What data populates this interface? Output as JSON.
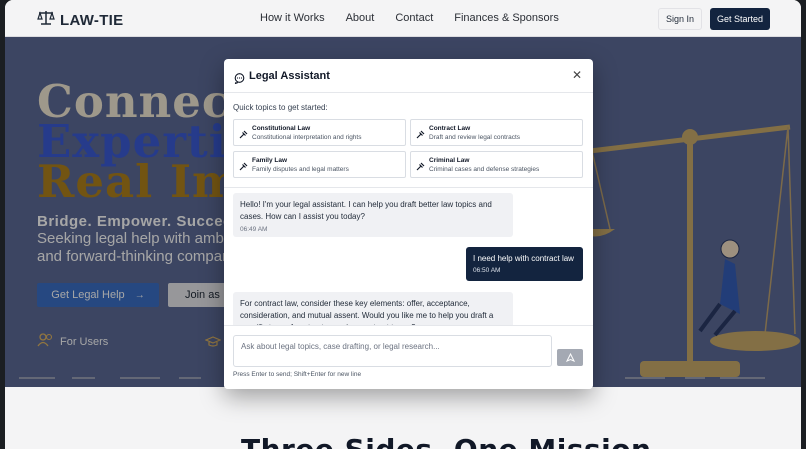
{
  "header": {
    "brand": "LAW-TIE",
    "nav": [
      "How it Works",
      "About",
      "Contact",
      "Finances & Sponsors"
    ],
    "sign_in": "Sign In",
    "get_started": "Get Started"
  },
  "hero": {
    "line1": "Connectin",
    "line2": "Expertise",
    "line3": "Real Impa",
    "tagline": "Bridge. Empower. Succeed.",
    "sub1": "Seeking legal help with ambit",
    "sub2": "and forward-thinking compan",
    "btn_legal": "Get Legal Help",
    "btn_join": "Join as",
    "for_users": "For Users"
  },
  "modal": {
    "title": "Legal Assistant",
    "quick_label": "Quick topics to get started:",
    "topics": [
      {
        "title": "Constitutional Law",
        "desc": "Constitutional interpretation and rights"
      },
      {
        "title": "Contract Law",
        "desc": "Draft and review legal contracts"
      },
      {
        "title": "Family Law",
        "desc": "Family disputes and legal matters"
      },
      {
        "title": "Criminal Law",
        "desc": "Criminal cases and defense strategies"
      }
    ],
    "messages": [
      {
        "from": "assistant",
        "text": "Hello! I'm your legal assistant. I can help you draft better law topics and cases. How can I assist you today?",
        "time": "06:49 AM"
      },
      {
        "from": "user",
        "text": "I need help with contract law",
        "time": "06:50 AM"
      },
      {
        "from": "assistant",
        "text": "For contract law, consider these key elements: offer, acceptance, consideration, and mutual assent. Would you like me to help you draft a specific type of contract or review contract terms?"
      }
    ],
    "input_placeholder": "Ask about legal topics, case drafting, or legal research...",
    "hint": "Press Enter to send; Shift+Enter for new line"
  },
  "section": {
    "heading": "Three Sides, One Mission"
  },
  "colors": {
    "navy": "#13243f",
    "hero_blue": "#3b5bd6",
    "hero_gold": "#b0821c",
    "button_blue": "#3b6fc6"
  },
  "icons": [
    "scales-icon",
    "chat-bubble-icon",
    "close-icon",
    "gavel-icon",
    "send-icon",
    "users-icon",
    "graduation-cap-icon",
    "arrow-right-icon"
  ]
}
